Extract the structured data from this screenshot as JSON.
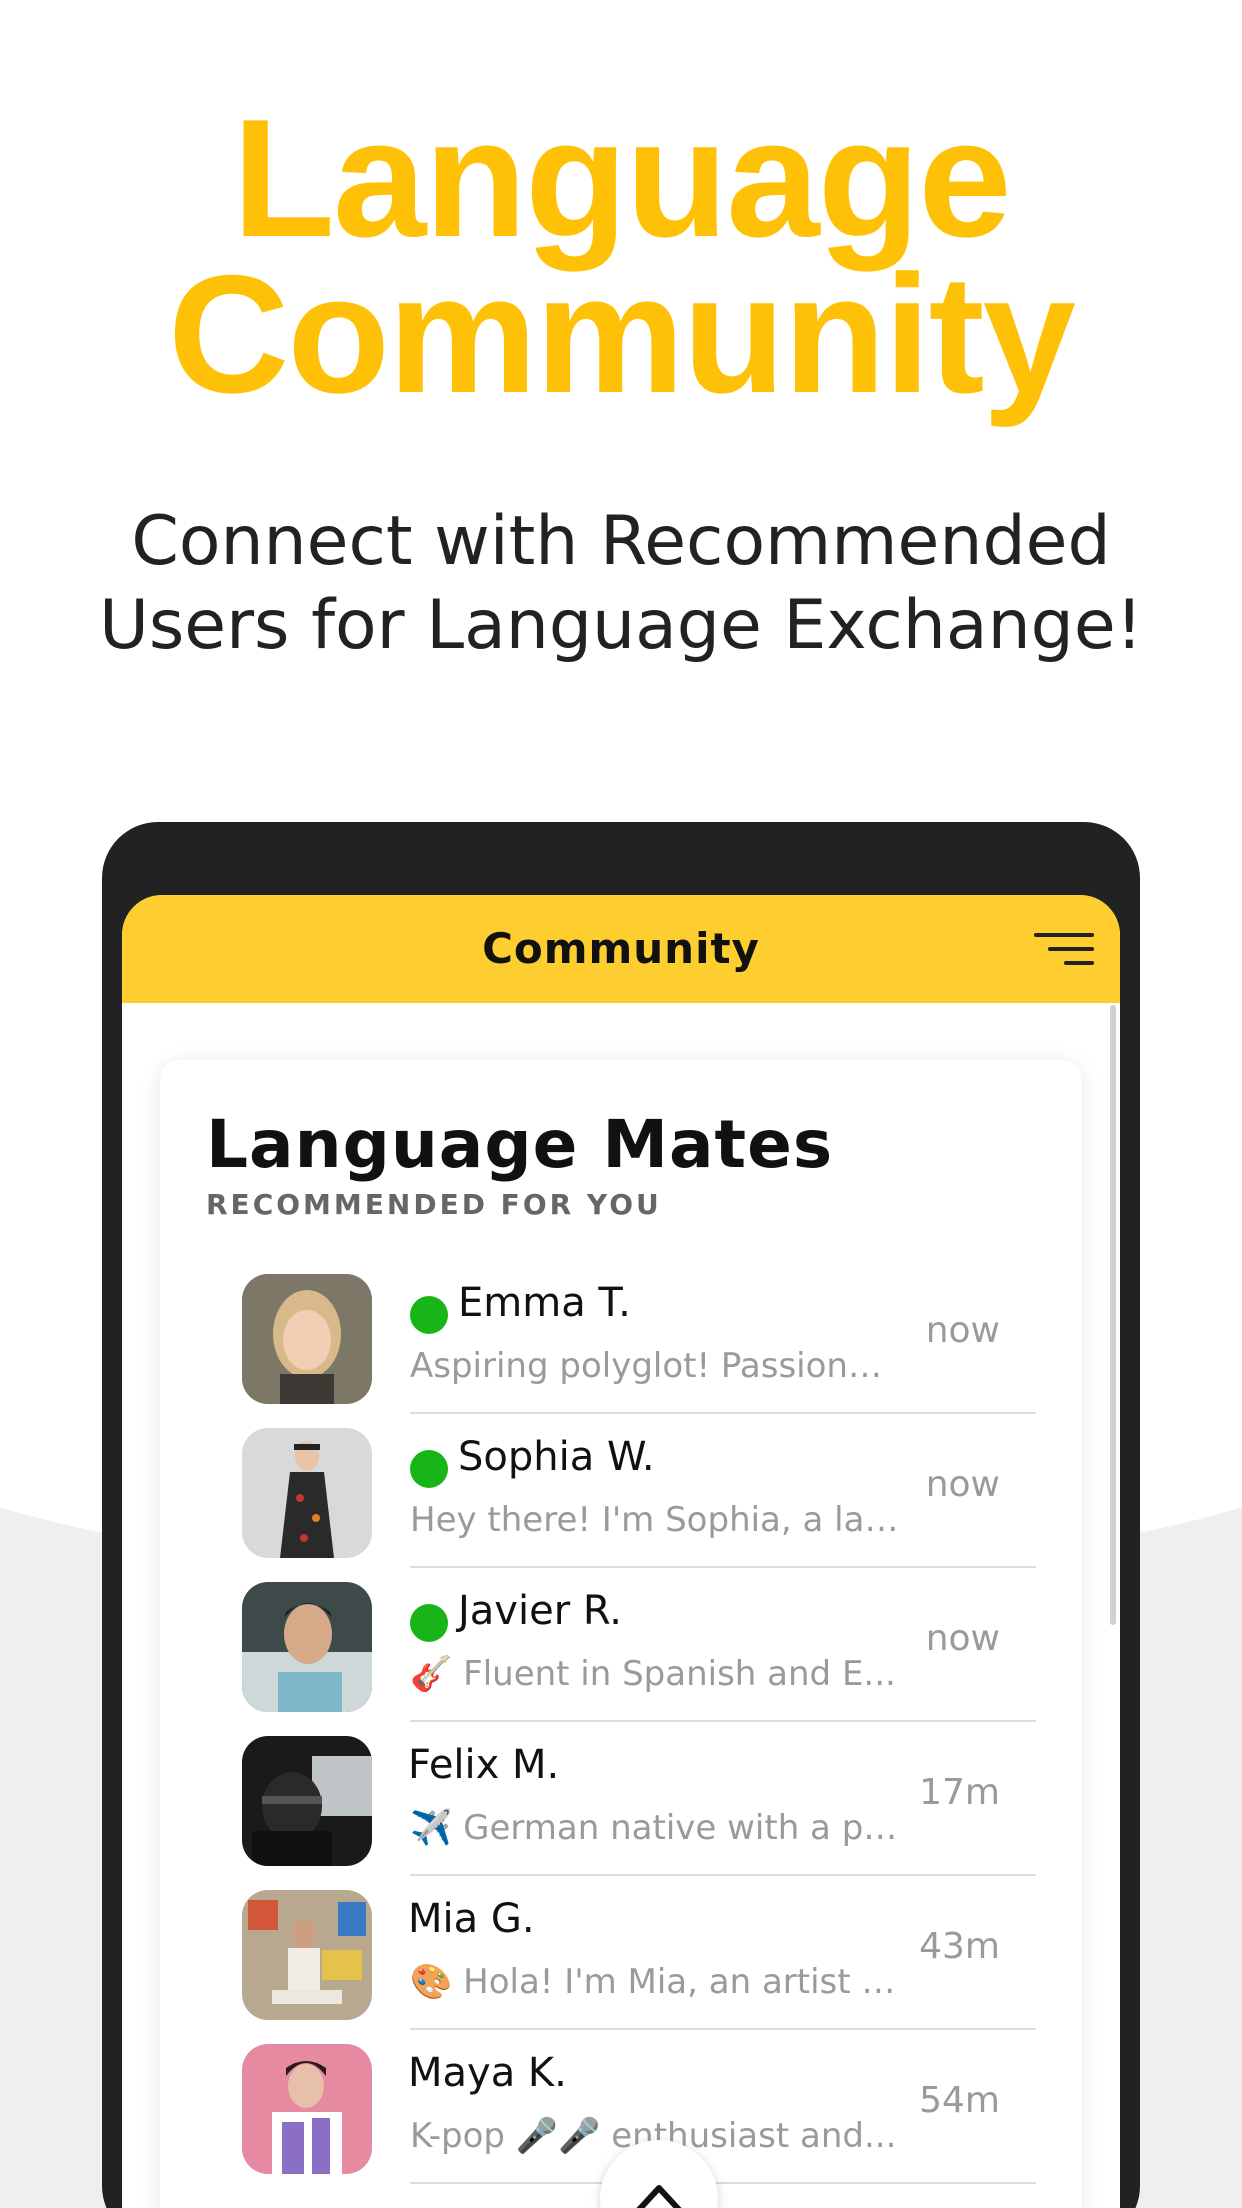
{
  "promo": {
    "headline_line1": "Language",
    "headline_line2": "Community",
    "subhead_line1": "Connect with Recommended",
    "subhead_line2": "Users for Language Exchange!"
  },
  "appbar": {
    "title": "Community",
    "filter_icon": "filter-icon"
  },
  "card": {
    "title": "Language Mates",
    "subtitle": "RECOMMENDED FOR YOU"
  },
  "users": [
    {
      "name": "Emma T.",
      "bio": "Aspiring polyglot! Passionat...",
      "time": "now",
      "online": true
    },
    {
      "name": "Sophia W.",
      "bio": "Hey there! I'm Sophia, a lan...",
      "time": "now",
      "online": true
    },
    {
      "name": "Javier R.",
      "bio": "🎸 Fluent in Spanish and E...",
      "time": "now",
      "online": true
    },
    {
      "name": "Felix M.",
      "bio": "✈️ German native with a pa...",
      "time": "17m",
      "online": false
    },
    {
      "name": "Mia G.",
      "bio": "🎨 Hola! I'm Mia, an artist a...",
      "time": "43m",
      "online": false
    },
    {
      "name": "Maya K.",
      "bio": "K-pop 🎤🎤 enthusiast and...",
      "time": "54m",
      "online": false
    }
  ],
  "colors": {
    "accent": "#FFC107",
    "appbar": "#FECD2F",
    "online": "#18b518"
  }
}
